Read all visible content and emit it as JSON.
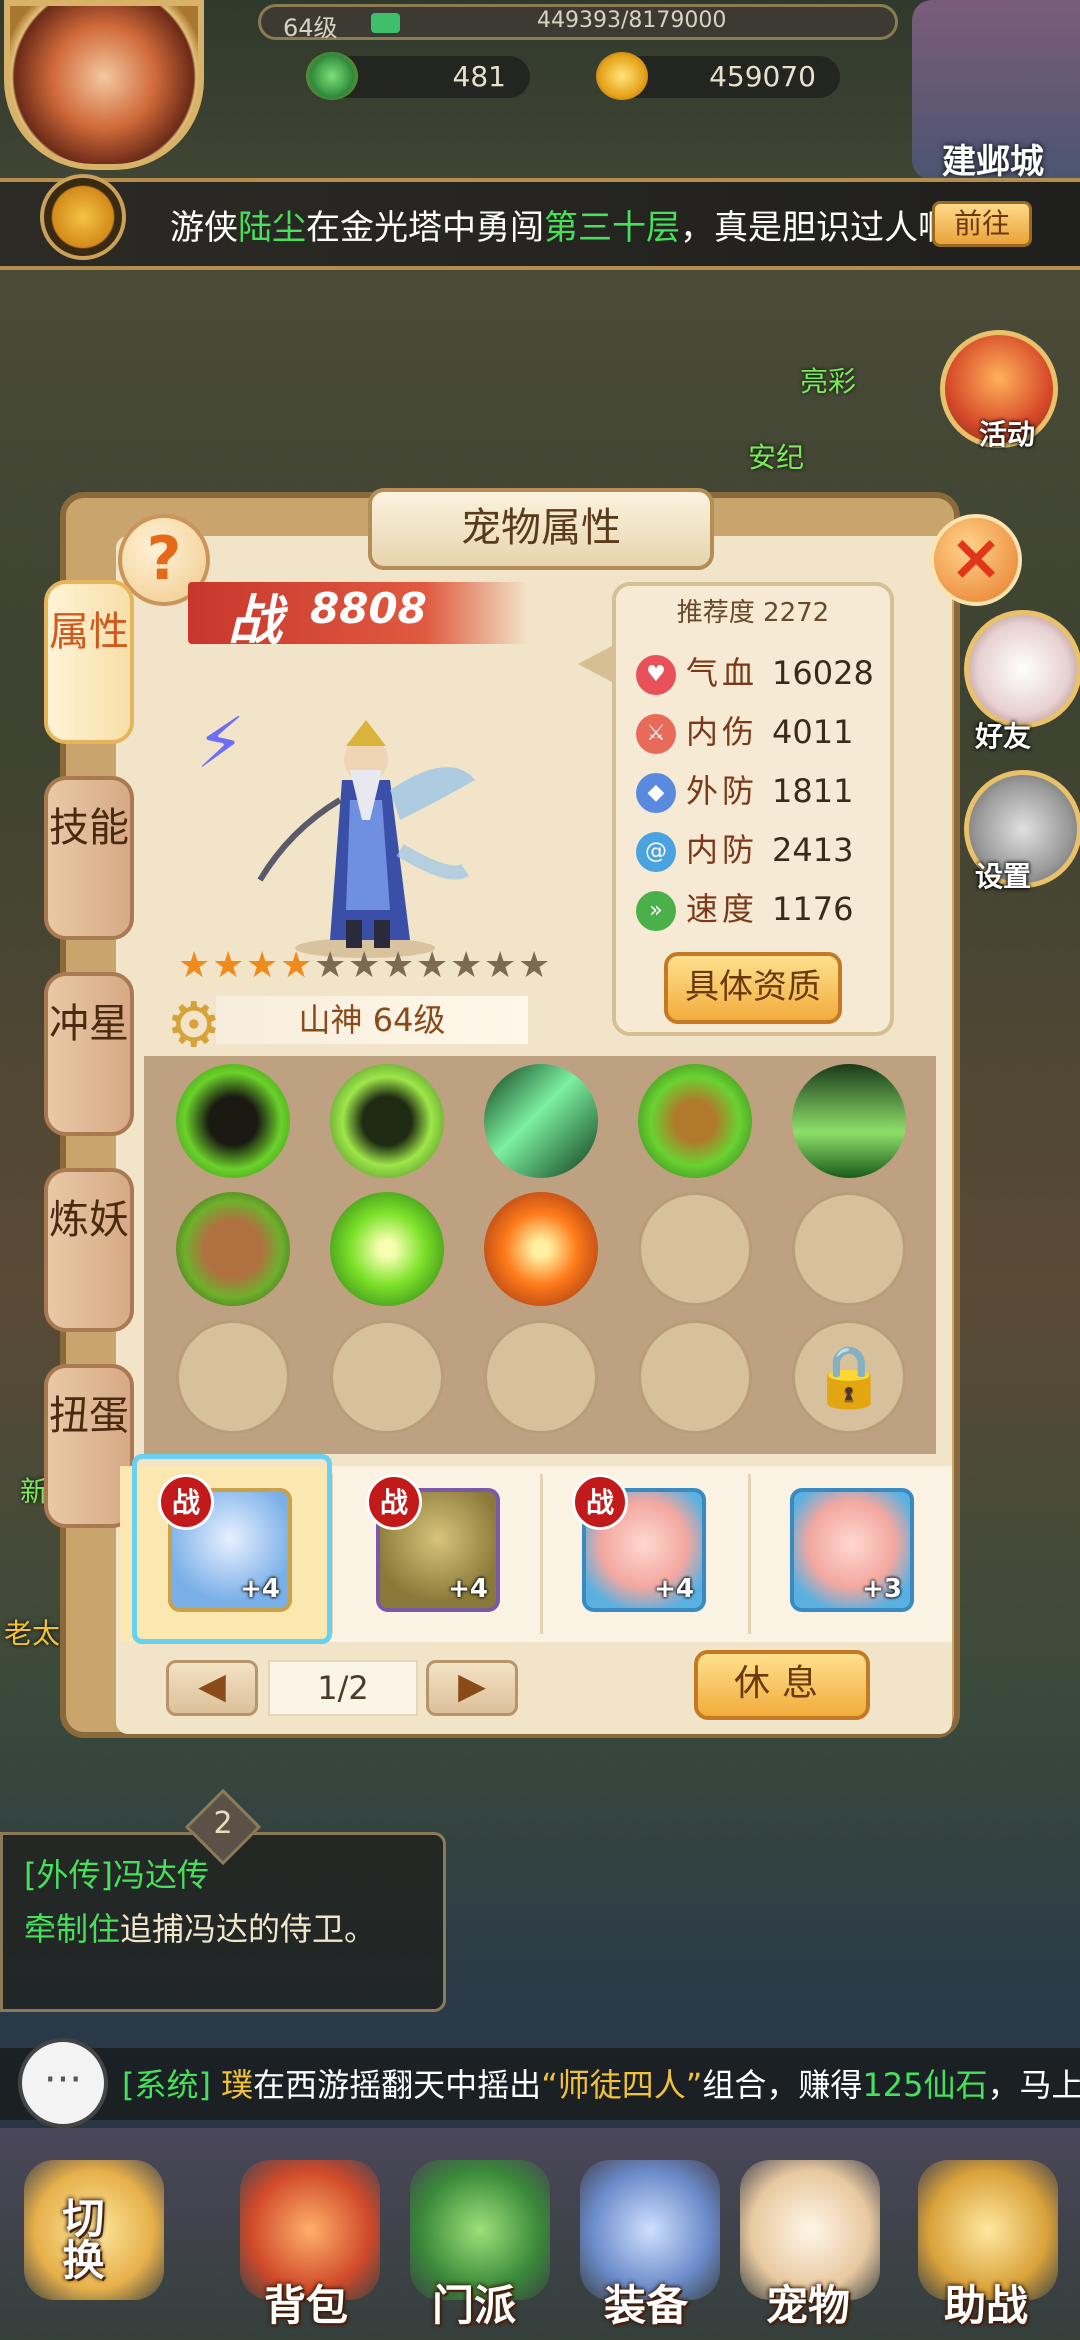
{
  "hud": {
    "level": "64级",
    "exp": "449393/8179000",
    "exp_progress": 0.055,
    "coins": "481",
    "gold": "459070",
    "city_label": "建邺城"
  },
  "broadcast": {
    "pre": "游侠",
    "name": "陆尘",
    "mid": "在金光塔中勇闯",
    "floor": "第三十层",
    "post": "，真是胆识过人啊~!",
    "goto_label": "前往"
  },
  "side": {
    "activity_label": "活动",
    "friends_label": "好友",
    "settings_label": "设置"
  },
  "npcs": [
    "亮彩",
    "安纪",
    "新",
    "老太叔"
  ],
  "panel": {
    "title": "宠物属性",
    "help_glyph": "?",
    "close_glyph": "×",
    "tabs": [
      {
        "label": "属性",
        "active": true
      },
      {
        "label": "技能",
        "active": false
      },
      {
        "label": "冲星",
        "active": false
      },
      {
        "label": "炼妖",
        "active": false
      },
      {
        "label": "扭蛋",
        "active": false
      }
    ],
    "power_label": "战",
    "power_value": "8808",
    "stars_total": 11,
    "stars_filled": 4,
    "pet_name": "山神 64级",
    "recommend_label": "推荐度",
    "recommend_value": "2272",
    "stats": [
      {
        "label": "气血",
        "value": "16028",
        "icon": "heart-icon",
        "color": "#e8505a"
      },
      {
        "label": "内伤",
        "value": "4011",
        "icon": "sword-icon",
        "color": "#e86a5a"
      },
      {
        "label": "外防",
        "value": "1811",
        "icon": "shield-icon",
        "color": "#5a8ae0"
      },
      {
        "label": "内防",
        "value": "2413",
        "icon": "swirl-icon",
        "color": "#4aa2e0"
      },
      {
        "label": "速度",
        "value": "1176",
        "icon": "boot-icon",
        "color": "#4ab04a"
      }
    ],
    "detail_button": "具体资质",
    "pets": [
      {
        "badge": "战",
        "level": "+4",
        "face": "#7ab0e8"
      },
      {
        "badge": "战",
        "level": "+4",
        "face": "#8a7a3a"
      },
      {
        "badge": "战",
        "level": "+4",
        "face": "#f2a8a0"
      },
      {
        "badge": "",
        "level": "+3",
        "face": "#f2a8a0"
      }
    ],
    "page": "1/2",
    "prev_glyph": "◀",
    "next_glyph": "▶",
    "rest_button": "休息"
  },
  "quest": {
    "number": "2",
    "title": "[外传]冯达传",
    "desc_action": "牵制住",
    "desc_rest": "追捕冯达的侍卫。"
  },
  "chat": {
    "icon_glyph": "···",
    "channel": "[系统]",
    "player": "璞",
    "mid": "在西游摇翻天中摇出",
    "combo": "“师徒四人”",
    "mid2": "组合，赚得",
    "reward": "125仙石",
    "post": "，马上来"
  },
  "menu": [
    {
      "label": "切换",
      "icon": "switch-icon"
    },
    {
      "label": "背包",
      "icon": "bag-icon"
    },
    {
      "label": "门派",
      "icon": "sect-icon"
    },
    {
      "label": "装备",
      "icon": "equipment-icon"
    },
    {
      "label": "宠物",
      "icon": "pet-icon"
    },
    {
      "label": "助战",
      "icon": "assist-icon"
    }
  ]
}
